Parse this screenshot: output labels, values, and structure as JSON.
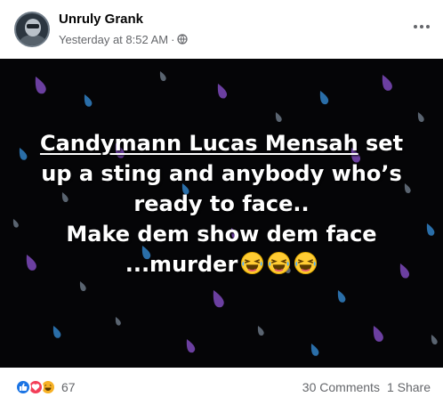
{
  "post": {
    "author": "Unruly Grank",
    "timestamp": "Yesterday at 8:52 AM",
    "separator": "·",
    "privacy_icon": "globe-icon",
    "more_icon": "more-horizontal-icon"
  },
  "image": {
    "background_color": "#050507",
    "drop_colors": [
      "#6b3fa0",
      "#2a6ea8",
      "#5a6470"
    ],
    "caption": {
      "line1_underlined": "Candymann Lucas Mensah",
      "line1_rest": " set",
      "line2": "up a sting and anybody who’s",
      "line3": "ready to face..",
      "line4": "Make dem show dem face",
      "line5": "...murder",
      "emojis": [
        "laughing-face-icon",
        "laughing-face-icon",
        "laughing-face-icon"
      ]
    }
  },
  "footer": {
    "reaction_icons": [
      "like-icon",
      "love-icon",
      "haha-icon"
    ],
    "reaction_count": "67",
    "comments": "30 Comments",
    "shares": "1 Share"
  },
  "colors": {
    "like": "#1b74e4",
    "love": "#f33e58",
    "haha": "#f7b125",
    "secondary_text": "#65676b"
  }
}
